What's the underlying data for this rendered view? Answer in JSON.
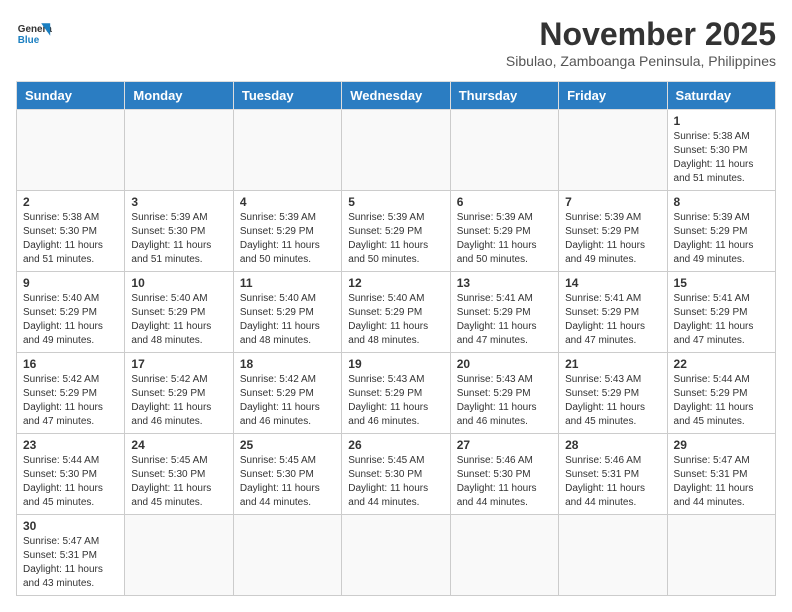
{
  "header": {
    "logo_general": "General",
    "logo_blue": "Blue",
    "month_title": "November 2025",
    "subtitle": "Sibulao, Zamboanga Peninsula, Philippines"
  },
  "days_of_week": [
    "Sunday",
    "Monday",
    "Tuesday",
    "Wednesday",
    "Thursday",
    "Friday",
    "Saturday"
  ],
  "weeks": [
    [
      {
        "day": "",
        "info": ""
      },
      {
        "day": "",
        "info": ""
      },
      {
        "day": "",
        "info": ""
      },
      {
        "day": "",
        "info": ""
      },
      {
        "day": "",
        "info": ""
      },
      {
        "day": "",
        "info": ""
      },
      {
        "day": "1",
        "info": "Sunrise: 5:38 AM\nSunset: 5:30 PM\nDaylight: 11 hours and 51 minutes."
      }
    ],
    [
      {
        "day": "2",
        "info": "Sunrise: 5:38 AM\nSunset: 5:30 PM\nDaylight: 11 hours and 51 minutes."
      },
      {
        "day": "3",
        "info": "Sunrise: 5:39 AM\nSunset: 5:30 PM\nDaylight: 11 hours and 51 minutes."
      },
      {
        "day": "4",
        "info": "Sunrise: 5:39 AM\nSunset: 5:29 PM\nDaylight: 11 hours and 50 minutes."
      },
      {
        "day": "5",
        "info": "Sunrise: 5:39 AM\nSunset: 5:29 PM\nDaylight: 11 hours and 50 minutes."
      },
      {
        "day": "6",
        "info": "Sunrise: 5:39 AM\nSunset: 5:29 PM\nDaylight: 11 hours and 50 minutes."
      },
      {
        "day": "7",
        "info": "Sunrise: 5:39 AM\nSunset: 5:29 PM\nDaylight: 11 hours and 49 minutes."
      },
      {
        "day": "8",
        "info": "Sunrise: 5:39 AM\nSunset: 5:29 PM\nDaylight: 11 hours and 49 minutes."
      }
    ],
    [
      {
        "day": "9",
        "info": "Sunrise: 5:40 AM\nSunset: 5:29 PM\nDaylight: 11 hours and 49 minutes."
      },
      {
        "day": "10",
        "info": "Sunrise: 5:40 AM\nSunset: 5:29 PM\nDaylight: 11 hours and 48 minutes."
      },
      {
        "day": "11",
        "info": "Sunrise: 5:40 AM\nSunset: 5:29 PM\nDaylight: 11 hours and 48 minutes."
      },
      {
        "day": "12",
        "info": "Sunrise: 5:40 AM\nSunset: 5:29 PM\nDaylight: 11 hours and 48 minutes."
      },
      {
        "day": "13",
        "info": "Sunrise: 5:41 AM\nSunset: 5:29 PM\nDaylight: 11 hours and 47 minutes."
      },
      {
        "day": "14",
        "info": "Sunrise: 5:41 AM\nSunset: 5:29 PM\nDaylight: 11 hours and 47 minutes."
      },
      {
        "day": "15",
        "info": "Sunrise: 5:41 AM\nSunset: 5:29 PM\nDaylight: 11 hours and 47 minutes."
      }
    ],
    [
      {
        "day": "16",
        "info": "Sunrise: 5:42 AM\nSunset: 5:29 PM\nDaylight: 11 hours and 47 minutes."
      },
      {
        "day": "17",
        "info": "Sunrise: 5:42 AM\nSunset: 5:29 PM\nDaylight: 11 hours and 46 minutes."
      },
      {
        "day": "18",
        "info": "Sunrise: 5:42 AM\nSunset: 5:29 PM\nDaylight: 11 hours and 46 minutes."
      },
      {
        "day": "19",
        "info": "Sunrise: 5:43 AM\nSunset: 5:29 PM\nDaylight: 11 hours and 46 minutes."
      },
      {
        "day": "20",
        "info": "Sunrise: 5:43 AM\nSunset: 5:29 PM\nDaylight: 11 hours and 46 minutes."
      },
      {
        "day": "21",
        "info": "Sunrise: 5:43 AM\nSunset: 5:29 PM\nDaylight: 11 hours and 45 minutes."
      },
      {
        "day": "22",
        "info": "Sunrise: 5:44 AM\nSunset: 5:29 PM\nDaylight: 11 hours and 45 minutes."
      }
    ],
    [
      {
        "day": "23",
        "info": "Sunrise: 5:44 AM\nSunset: 5:30 PM\nDaylight: 11 hours and 45 minutes."
      },
      {
        "day": "24",
        "info": "Sunrise: 5:45 AM\nSunset: 5:30 PM\nDaylight: 11 hours and 45 minutes."
      },
      {
        "day": "25",
        "info": "Sunrise: 5:45 AM\nSunset: 5:30 PM\nDaylight: 11 hours and 44 minutes."
      },
      {
        "day": "26",
        "info": "Sunrise: 5:45 AM\nSunset: 5:30 PM\nDaylight: 11 hours and 44 minutes."
      },
      {
        "day": "27",
        "info": "Sunrise: 5:46 AM\nSunset: 5:30 PM\nDaylight: 11 hours and 44 minutes."
      },
      {
        "day": "28",
        "info": "Sunrise: 5:46 AM\nSunset: 5:31 PM\nDaylight: 11 hours and 44 minutes."
      },
      {
        "day": "29",
        "info": "Sunrise: 5:47 AM\nSunset: 5:31 PM\nDaylight: 11 hours and 44 minutes."
      }
    ],
    [
      {
        "day": "30",
        "info": "Sunrise: 5:47 AM\nSunset: 5:31 PM\nDaylight: 11 hours and 43 minutes."
      },
      {
        "day": "",
        "info": ""
      },
      {
        "day": "",
        "info": ""
      },
      {
        "day": "",
        "info": ""
      },
      {
        "day": "",
        "info": ""
      },
      {
        "day": "",
        "info": ""
      },
      {
        "day": "",
        "info": ""
      }
    ]
  ]
}
